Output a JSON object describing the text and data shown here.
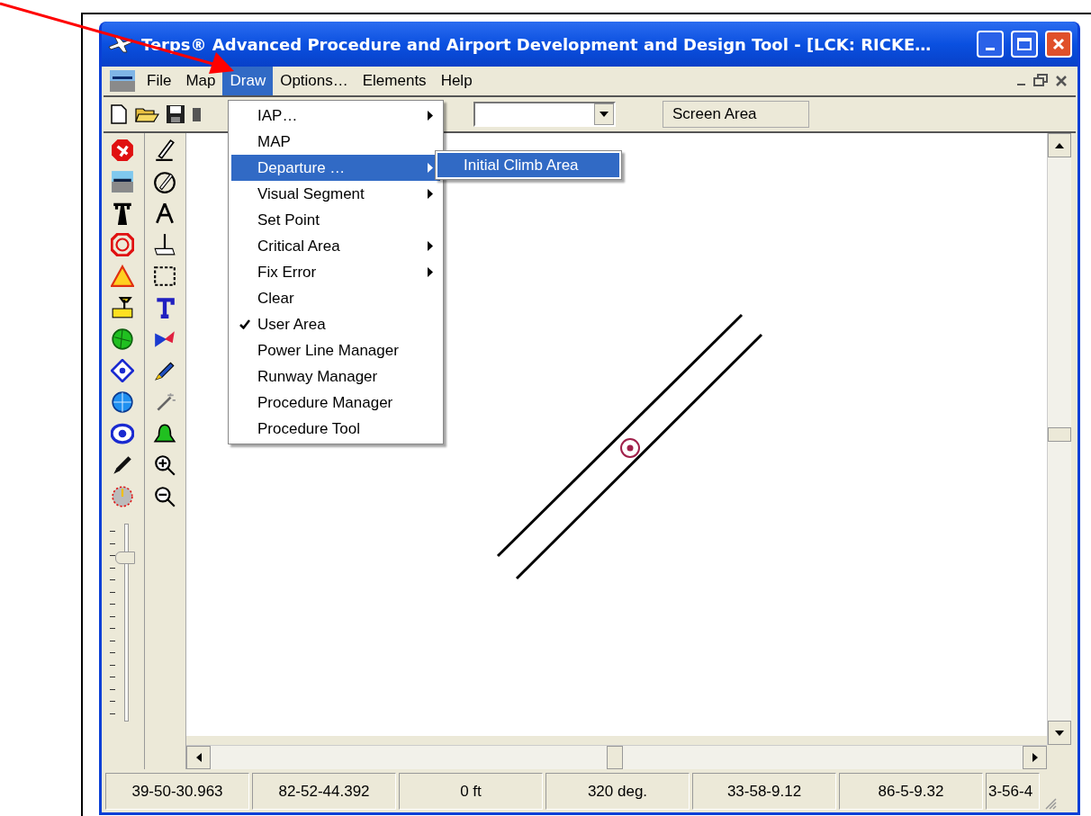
{
  "window": {
    "title": "Terps® Advanced Procedure and Airport Development and Design Tool - [LCK: RICKE…"
  },
  "menu_bar": {
    "items": [
      {
        "label": "File",
        "selected": false
      },
      {
        "label": "Map",
        "selected": false
      },
      {
        "label": "Draw",
        "selected": true
      },
      {
        "label": "Options…",
        "selected": false
      },
      {
        "label": "Elements",
        "selected": false
      },
      {
        "label": "Help",
        "selected": false
      }
    ]
  },
  "toolbar": {
    "screen_area": "Screen Area"
  },
  "draw_menu": {
    "items": [
      {
        "label": "IAP…",
        "submenu": true,
        "checked": false,
        "selected": false
      },
      {
        "label": "MAP",
        "submenu": false,
        "checked": false,
        "selected": false
      },
      {
        "label": "Departure …",
        "submenu": true,
        "checked": false,
        "selected": true
      },
      {
        "label": "Visual Segment",
        "submenu": true,
        "checked": false,
        "selected": false
      },
      {
        "label": "Set Point",
        "submenu": false,
        "checked": false,
        "selected": false
      },
      {
        "label": "Critical Area",
        "submenu": true,
        "checked": false,
        "selected": false
      },
      {
        "label": "Fix Error",
        "submenu": true,
        "checked": false,
        "selected": false
      },
      {
        "label": "Clear",
        "submenu": false,
        "checked": false,
        "selected": false
      },
      {
        "label": "User Area",
        "submenu": false,
        "checked": true,
        "selected": false
      },
      {
        "label": "Power Line Manager",
        "submenu": false,
        "checked": false,
        "selected": false
      },
      {
        "label": "Runway Manager",
        "submenu": false,
        "checked": false,
        "selected": false
      },
      {
        "label": "Procedure Manager",
        "submenu": false,
        "checked": false,
        "selected": false
      },
      {
        "label": "Procedure Tool",
        "submenu": false,
        "checked": false,
        "selected": false
      }
    ]
  },
  "submenu": {
    "items": [
      {
        "label": "Initial Climb Area",
        "selected": true
      }
    ]
  },
  "zoom_slider": {
    "level": 0.85
  },
  "status_bar": [
    "39-50-30.963",
    "82-52-44.392",
    "0 ft",
    "320 deg.",
    "33-58-9.12",
    "86-5-9.32",
    "3-56-4"
  ]
}
